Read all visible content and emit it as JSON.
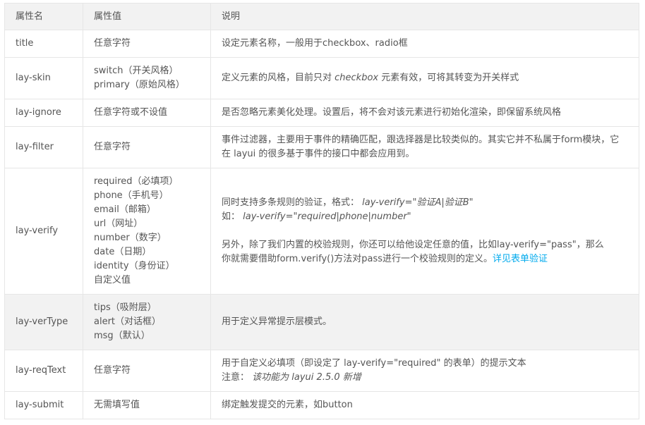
{
  "headers": [
    "属性名",
    "属性值",
    "说明"
  ],
  "rows": {
    "title": {
      "name": "title",
      "values": [
        "任意字符"
      ],
      "desc": "设定元素名称，一般用于checkbox、radio框"
    },
    "lay_skin": {
      "name": "lay-skin",
      "values": [
        "switch（开关风格）",
        "primary（原始风格）"
      ],
      "desc_before": "定义元素的风格，目前只对 ",
      "desc_em": "checkbox",
      "desc_after": " 元素有效，可将其转变为开关样式"
    },
    "lay_ignore": {
      "name": "lay-ignore",
      "values": [
        "任意字符或不设值"
      ],
      "desc": "是否忽略元素美化处理。设置后，将不会对该元素进行初始化渲染，即保留系统风格"
    },
    "lay_filter": {
      "name": "lay-filter",
      "values": [
        "任意字符"
      ],
      "desc": "事件过滤器，主要用于事件的精确匹配，跟选择器是比较类似的。其实它并不私属于form模块，它在 layui 的很多基于事件的接口中都会应用到。"
    },
    "lay_verify": {
      "name": "lay-verify",
      "values": [
        "required（必填项）",
        "phone（手机号）",
        "email（邮箱）",
        "url（网址）",
        "number（数字）",
        "date（日期）",
        "identity（身份证）",
        "自定义值"
      ],
      "desc_line1_text": "同时支持多条规则的验证，格式：",
      "desc_line1_code": "lay-verify=\"验证A|验证B\"",
      "desc_line2_text": "如：",
      "desc_line2_code": "lay-verify=\"required|phone|number\"",
      "desc_para2_a": "另外，除了我们内置的校验规则，你还可以给他设定任意的值，比如lay-verify=\"pass\"，那么",
      "desc_para2_b": "你就需要借助form.verify()方法对pass进行一个校验规则的定义。",
      "desc_link": "详见表单验证"
    },
    "lay_vertype": {
      "name": "lay-verType",
      "values": [
        "tips（吸附层）",
        "alert（对话框）",
        "msg（默认）"
      ],
      "desc": "用于定义异常提示层模式。"
    },
    "lay_reqtext": {
      "name": "lay-reqText",
      "values": [
        "任意字符"
      ],
      "desc_line1": "用于自定义必填项（即设定了 lay-verify=\"required\" 的表单）的提示文本",
      "desc_note_label": "注意：",
      "desc_note_em": "该功能为 layui 2.5.0 新增"
    },
    "lay_submit": {
      "name": "lay-submit",
      "values": [
        "无需填写值"
      ],
      "desc": "绑定触发提交的元素，如button"
    }
  },
  "colors": {
    "header_bg": "#f2f2f2",
    "border": "#e6e6e6",
    "text": "#555555",
    "link": "#01aaed"
  }
}
